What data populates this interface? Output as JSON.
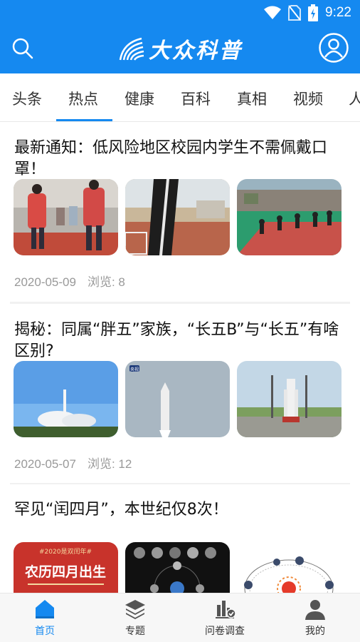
{
  "status": {
    "time": "9:22"
  },
  "header": {
    "logo_text": "大众科普"
  },
  "tabs": [
    {
      "label": "头条"
    },
    {
      "label": "热点"
    },
    {
      "label": "健康"
    },
    {
      "label": "百科"
    },
    {
      "label": "真相"
    },
    {
      "label": "视频"
    },
    {
      "label": "人"
    }
  ],
  "active_tab": "热点",
  "articles": [
    {
      "title": "最新通知：低风险地区校园内学生不需佩戴口罩！",
      "date": "2020-05-09",
      "views": "浏览: 8"
    },
    {
      "title": "揭秘：同属“胖五”家族，“长五B”与“长五”有啥区别?",
      "date": "2020-05-07",
      "views": "浏览: 12"
    },
    {
      "title": "罕见“闰四月”，本世纪仅8次！",
      "date": "",
      "views": ""
    }
  ],
  "thumb_texts": {
    "calendar_tag": "#2020是双闰年#",
    "calendar_title": "农历四月出生",
    "cctv": "央视"
  },
  "bottom_nav": [
    {
      "label": "首页"
    },
    {
      "label": "专题"
    },
    {
      "label": "问卷调查"
    },
    {
      "label": "我的"
    }
  ],
  "colors": {
    "brand": "#1589f0",
    "text": "#111111",
    "muted": "#999999"
  }
}
